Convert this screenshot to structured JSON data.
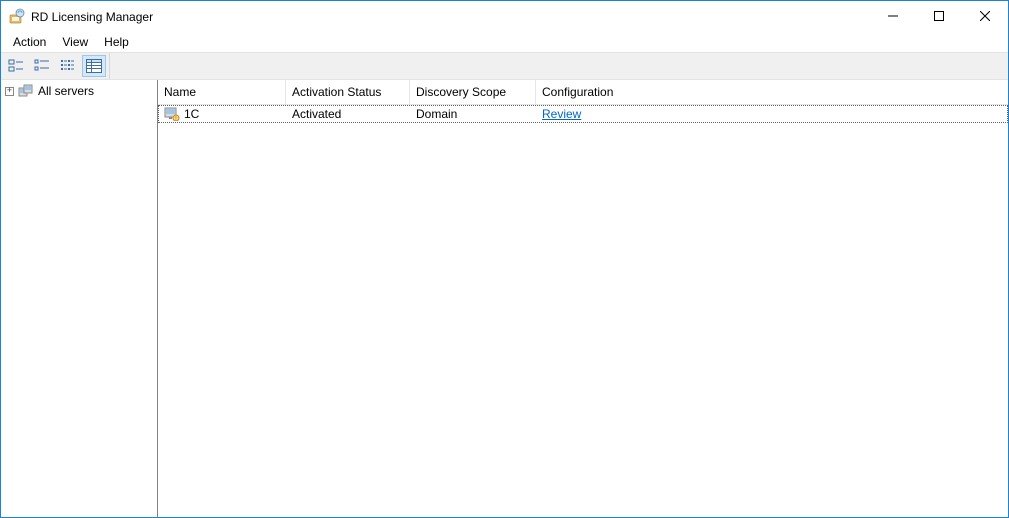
{
  "window": {
    "title": "RD Licensing Manager"
  },
  "menu": {
    "action": "Action",
    "view": "View",
    "help": "Help"
  },
  "tree": {
    "root_label": "All servers"
  },
  "columns": {
    "name": "Name",
    "activation_status": "Activation Status",
    "discovery_scope": "Discovery Scope",
    "configuration": "Configuration"
  },
  "rows": [
    {
      "name": "1C",
      "activation_status": "Activated",
      "discovery_scope": "Domain",
      "configuration": "Review"
    }
  ]
}
